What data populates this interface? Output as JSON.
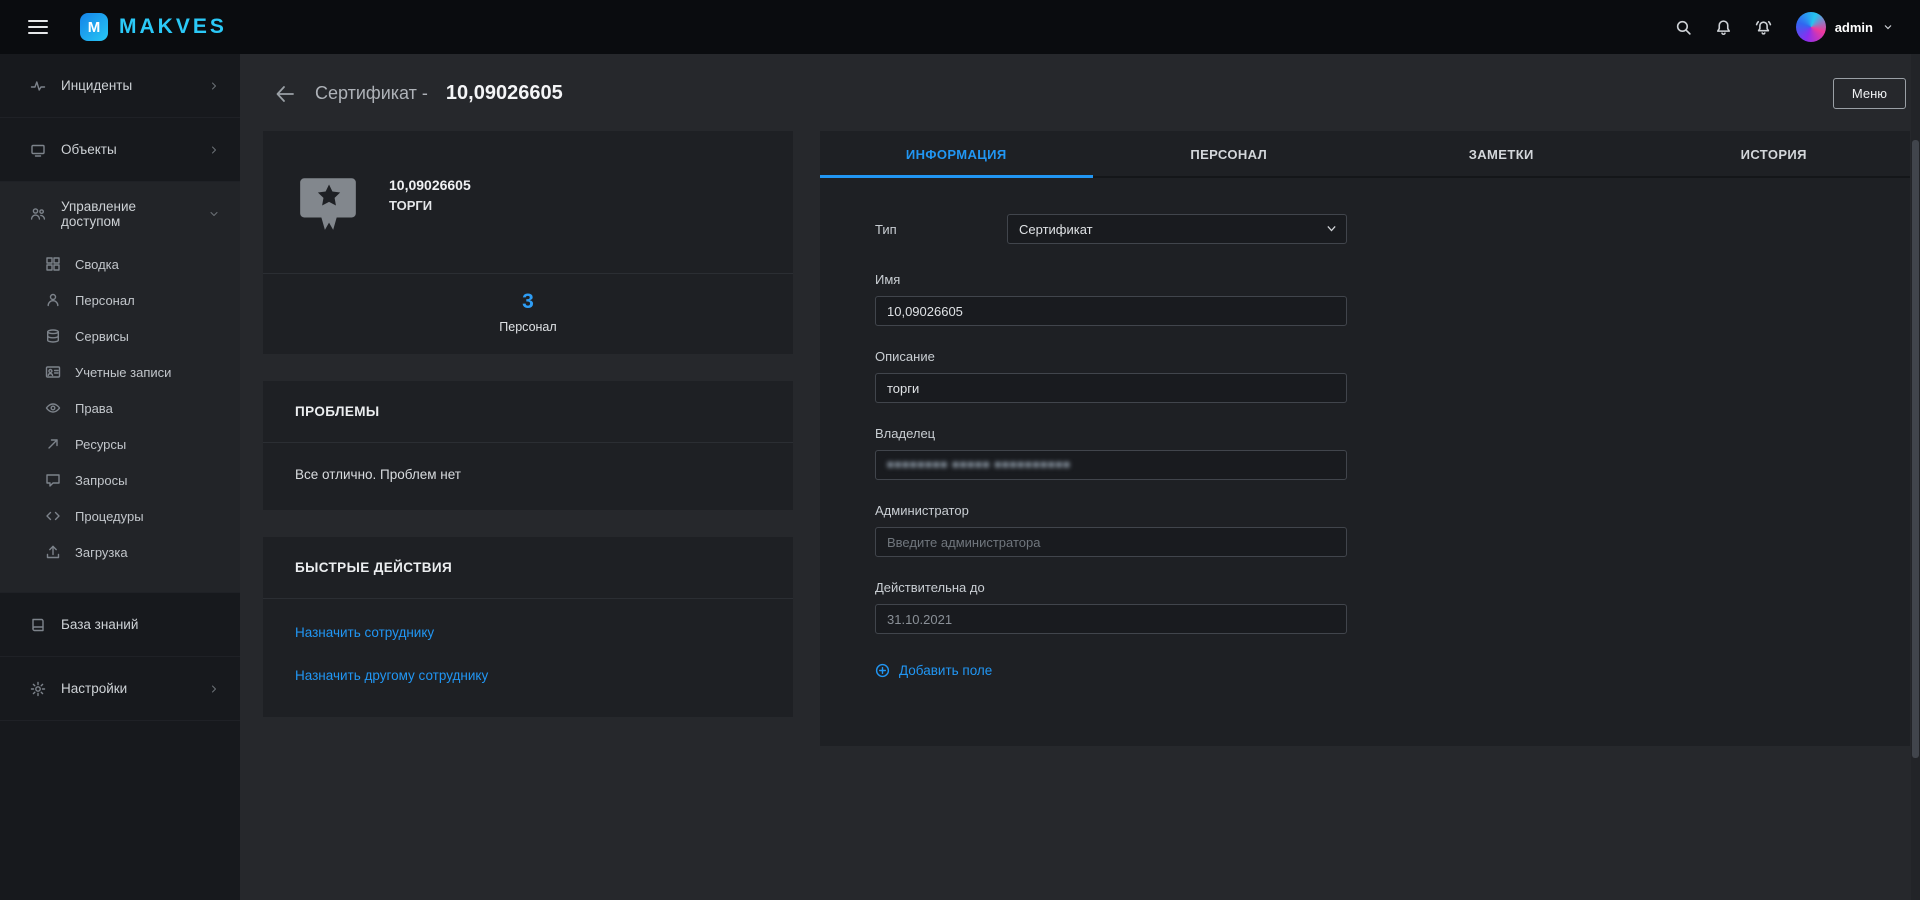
{
  "colors": {
    "brand_cyan": "#2bc9f7",
    "accent_blue": "#2196f3",
    "topbar_bg": "#0a0c0f",
    "sidebar_bg": "#17191d",
    "page_bg": "#26282c",
    "card_bg": "#1e2024"
  },
  "topbar": {
    "logo_badge_letter": "M",
    "logo_text": "MAKVES",
    "user_name": "admin",
    "icons": {
      "hamburger": "menu-lines",
      "search": "magnifier",
      "notifications": "bell",
      "alerts": "bell-ring",
      "user_menu": "chevron-down",
      "avatar": "user-avatar-gradient"
    }
  },
  "sidebar": {
    "top_items": [
      {
        "label": "Инциденты",
        "icon": "incidents-icon"
      },
      {
        "label": "Объекты",
        "icon": "objects-icon"
      }
    ],
    "group": {
      "label": "Управление доступом",
      "icon": "access-management-icon",
      "expanded": true,
      "items": [
        {
          "label": "Сводка",
          "icon": "summary-grid-icon"
        },
        {
          "label": "Персонал",
          "icon": "person-icon"
        },
        {
          "label": "Сервисы",
          "icon": "services-icon"
        },
        {
          "label": "Учетные записи",
          "icon": "accounts-icon"
        },
        {
          "label": "Права",
          "icon": "rights-icon"
        },
        {
          "label": "Ресурсы",
          "icon": "resources-icon"
        },
        {
          "label": "Запросы",
          "icon": "requests-icon"
        },
        {
          "label": "Процедуры",
          "icon": "procedures-icon"
        },
        {
          "label": "Загрузка",
          "icon": "upload-icon"
        }
      ]
    },
    "bottom_items": [
      {
        "label": "База знаний",
        "icon": "knowledge-base-icon"
      },
      {
        "label": "Настройки",
        "icon": "settings-gear-icon"
      }
    ]
  },
  "page_header": {
    "title_prefix": "Сертификат -",
    "title_id": "10,09026605",
    "menu_button": "Меню"
  },
  "summary_card": {
    "icon": "certificate-award-icon",
    "name": "10,09026605",
    "subtitle": "ТОРГИ",
    "count": "3",
    "count_label": "Персонал"
  },
  "problems_card": {
    "title": "ПРОБЛЕМЫ",
    "message": "Все отлично. Проблем нет"
  },
  "quick_actions_card": {
    "title": "БЫСТРЫЕ ДЕЙСТВИЯ",
    "actions": [
      {
        "label": "Назначить сотруднику"
      },
      {
        "label": "Назначить другому сотруднику"
      }
    ]
  },
  "tabs": [
    {
      "label": "ИНФОРМАЦИЯ",
      "active": true
    },
    {
      "label": "ПЕРСОНАЛ",
      "active": false
    },
    {
      "label": "ЗАМЕТКИ",
      "active": false
    },
    {
      "label": "ИСТОРИЯ",
      "active": false
    }
  ],
  "form": {
    "type": {
      "label": "Тип",
      "value": "Сертификат"
    },
    "name": {
      "label": "Имя",
      "value": "10,09026605"
    },
    "description": {
      "label": "Описание",
      "value": "торги"
    },
    "owner": {
      "label": "Владелец",
      "value_blurred": "■■■■■■■■ ■■■■■ ■■■■■■■■■■",
      "note": "value blurred in source"
    },
    "administrator": {
      "label": "Администратор",
      "placeholder": "Введите администратора"
    },
    "valid_until": {
      "label": "Действительна до",
      "value": "31.10.2021"
    },
    "add_field_label": "Добавить поле"
  }
}
